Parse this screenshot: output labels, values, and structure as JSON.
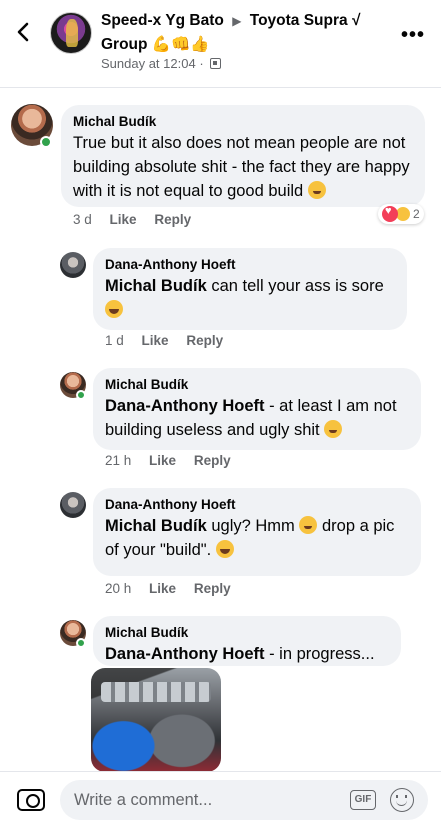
{
  "header": {
    "title_part1": "Speed-x Yg Bato",
    "title_arrow": "▶",
    "title_part2": "Toyota Supra √ Group",
    "title_emojis": "💪👊👍",
    "timestamp": "Sunday at 12:04",
    "separator": "·",
    "privacy_icon": "group-privacy-icon",
    "back_icon": "chevron-left-icon",
    "more_icon": "more-dots-icon",
    "more_label": "•••"
  },
  "comments": [
    {
      "author": "Michal Budík",
      "text": "True but it also does not mean people are not building absolute shit - the fact they are happy with it is not equal to good build",
      "emoji": "wink-emoji",
      "time": "3 d",
      "like": "Like",
      "reply": "Reply",
      "reaction_count": "2",
      "reactions": [
        "love-reaction",
        "haha-reaction"
      ],
      "online": true
    },
    {
      "author": "Dana-Anthony Hoeft",
      "tag": "Michal Budík",
      "text": " can tell your ass is sore",
      "emoji": "laugh-emoji",
      "time": "1 d",
      "like": "Like",
      "reply": "Reply",
      "online": false
    },
    {
      "author": "Michal Budík",
      "tag": "Dana-Anthony Hoeft",
      "text": " - at least I am not building useless and ugly shit",
      "emoji": "grin-emoji",
      "time": "21 h",
      "like": "Like",
      "reply": "Reply",
      "online": true
    },
    {
      "author": "Dana-Anthony Hoeft",
      "tag": "Michal Budík",
      "text_before": " ugly? Hmm",
      "text_after": " drop a pic of your \"build\".",
      "emoji_mid": "thinking-emoji",
      "emoji": "laugh-emoji",
      "time": "20 h",
      "like": "Like",
      "reply": "Reply",
      "online": false
    },
    {
      "author": "Michal Budík",
      "tag": "Dana-Anthony Hoeft",
      "text": " - in progress...",
      "attachment": "engine-bay-photo",
      "online": true
    }
  ],
  "composer": {
    "placeholder": "Write a comment...",
    "camera_icon": "camera-icon",
    "gif_label": "GIF",
    "sticker_icon": "sticker-icon"
  },
  "colors": {
    "bubble": "#f0f2f5",
    "muted_text": "#65676b",
    "online": "#31a24c",
    "love": "#f33e58",
    "haha": "#f7c23e"
  }
}
